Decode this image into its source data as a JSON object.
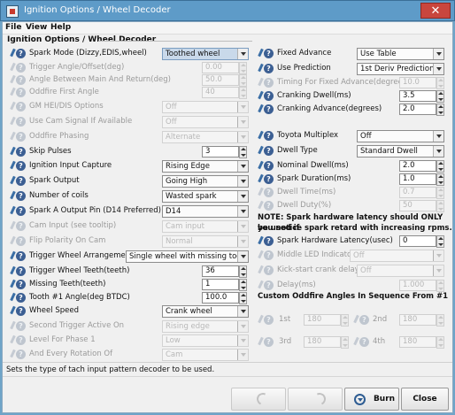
{
  "window": {
    "title": "Ignition Options / Wheel Decoder",
    "close_glyph": "✕"
  },
  "menu": [
    "File",
    "View",
    "Help"
  ],
  "panel_title": "Ignition Options / Wheel Decoder",
  "left": {
    "spark_mode": {
      "label": "Spark Mode (Dizzy,EDIS,wheel)",
      "value": "Toothed wheel"
    },
    "trigger_angle": {
      "label": "Trigger Angle/Offset(deg)",
      "value": "0.00"
    },
    "angle_main_return": {
      "label": "Angle Between Main And Return(deg)",
      "value": "50.0"
    },
    "oddfire_first_angle": {
      "label": "Oddfire First Angle",
      "value": "40"
    },
    "gm_hei_dis": {
      "label": "GM HEI/DIS Options",
      "value": "Off"
    },
    "use_cam_signal": {
      "label": "Use Cam Signal If Available",
      "value": "Off"
    },
    "oddfire_phasing": {
      "label": "Oddfire Phasing",
      "value": "Alternate"
    },
    "skip_pulses": {
      "label": "Skip Pulses",
      "value": "3"
    },
    "ignition_input_capture": {
      "label": "Ignition Input Capture",
      "value": "Rising Edge"
    },
    "spark_output": {
      "label": "Spark Output",
      "value": "Going High"
    },
    "number_of_coils": {
      "label": "Number of coils",
      "value": "Wasted spark"
    },
    "spark_a_output_pin": {
      "label": "Spark A Output Pin (D14 Preferred)",
      "value": "D14"
    },
    "cam_input": {
      "label": "Cam Input (see tooltip)",
      "value": "Cam input"
    },
    "flip_polarity_cam": {
      "label": "Flip Polarity On Cam",
      "value": "Normal"
    },
    "trigger_wheel_arrangement": {
      "label": "Trigger Wheel Arrangement",
      "value": "Single wheel with missing tooth"
    },
    "trigger_wheel_teeth": {
      "label": "Trigger Wheel Teeth(teeth)",
      "value": "36"
    },
    "missing_teeth": {
      "label": "Missing Teeth(teeth)",
      "value": "1"
    },
    "tooth1_angle": {
      "label": "Tooth #1 Angle(deg BTDC)",
      "value": "100.0"
    },
    "wheel_speed": {
      "label": "Wheel Speed",
      "value": "Crank wheel"
    },
    "second_trigger_active": {
      "label": "Second Trigger Active On",
      "value": "Rising edge"
    },
    "level_phase1": {
      "label": "Level For Phase 1",
      "value": "Low"
    },
    "every_rotation": {
      "label": "And Every Rotation Of",
      "value": "Cam"
    }
  },
  "right": {
    "fixed_advance": {
      "label": "Fixed Advance",
      "value": "Use Table"
    },
    "use_prediction": {
      "label": "Use Prediction",
      "value": "1st Deriv Prediction"
    },
    "timing_fixed_advance": {
      "label": "Timing For Fixed Advance(degrees)",
      "value": "10.0"
    },
    "cranking_dwell": {
      "label": "Cranking Dwell(ms)",
      "value": "3.5"
    },
    "cranking_advance": {
      "label": "Cranking Advance(degrees)",
      "value": "2.0"
    },
    "toyota_multiplex": {
      "label": "Toyota Multiplex",
      "value": "Off"
    },
    "dwell_type": {
      "label": "Dwell Type",
      "value": "Standard Dwell"
    },
    "nominal_dwell": {
      "label": "Nominal Dwell(ms)",
      "value": "2.0"
    },
    "spark_duration": {
      "label": "Spark Duration(ms)",
      "value": "1.0"
    },
    "dwell_time": {
      "label": "Dwell Time(ms)",
      "value": "0.7"
    },
    "dwell_duty": {
      "label": "Dwell Duty(%)",
      "value": "50"
    },
    "note_line1": "NOTE: Spark hardware latency should ONLY be used if",
    "note_line2": "you notice spark retard with increasing rpms.",
    "spark_hw_latency": {
      "label": "Spark Hardware Latency(usec)",
      "value": "0"
    },
    "middle_led": {
      "label": "Middle LED Indicator",
      "value": "Off"
    },
    "kick_start_crank_delay": {
      "label": "Kick-start crank delay",
      "value": "Off"
    },
    "delay": {
      "label": "Delay(ms)",
      "value": "1.000"
    },
    "oddfire_section": "Custom Oddfire Angles In Sequence From #1",
    "oddfire_1st": {
      "label": "1st",
      "value": "180"
    },
    "oddfire_2nd": {
      "label": "2nd",
      "value": "180"
    },
    "oddfire_3rd": {
      "label": "3rd",
      "value": "180"
    },
    "oddfire_4th": {
      "label": "4th",
      "value": "180"
    }
  },
  "status": "Sets the type of tach input pattern decoder to be used.",
  "buttons": {
    "burn": "Burn",
    "close": "Close"
  },
  "colors": {
    "title_bar": "#5e9bc8",
    "help_icon": "#3c5f93",
    "highlight": "#c9d9ea"
  }
}
